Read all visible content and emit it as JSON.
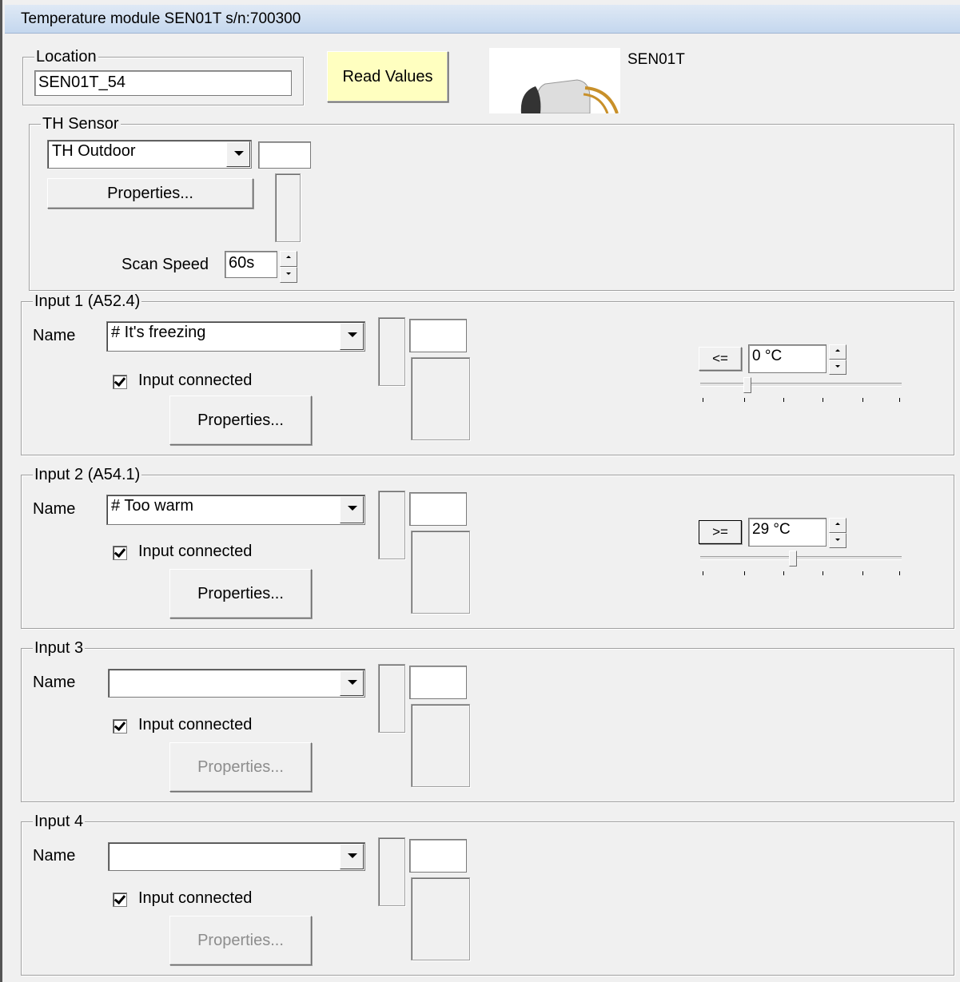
{
  "window": {
    "title": "Temperature module SEN01T s/n:700300"
  },
  "location": {
    "legend": "Location",
    "value": "SEN01T_54"
  },
  "read_values_label": "Read Values",
  "module_name": "SEN01T",
  "th_sensor": {
    "legend": "TH Sensor",
    "selected": "TH Outdoor",
    "properties_label": "Properties...",
    "scan_speed_label": "Scan Speed",
    "scan_speed_value": "60s"
  },
  "inputs": [
    {
      "legend": "Input 1 (A52.4)",
      "name_label": "Name",
      "name_value": "# It's freezing",
      "connected_label": "Input connected",
      "connected": true,
      "properties_label": "Properties...",
      "compare_label": "<=",
      "threshold": "0 °C",
      "slider_level": 0.2,
      "properties_enabled": true
    },
    {
      "legend": "Input 2 (A54.1)",
      "name_label": "Name",
      "name_value": "# Too warm",
      "connected_label": "Input connected",
      "connected": true,
      "properties_label": "Properties...",
      "compare_label": ">=",
      "threshold": "29 °C",
      "slider_level": 0.45,
      "properties_enabled": true
    },
    {
      "legend": "Input 3",
      "name_label": "Name",
      "name_value": "",
      "connected_label": "Input connected",
      "connected": true,
      "properties_label": "Properties...",
      "properties_enabled": false
    },
    {
      "legend": "Input 4",
      "name_label": "Name",
      "name_value": "",
      "connected_label": "Input connected",
      "connected": true,
      "properties_label": "Properties...",
      "properties_enabled": false
    }
  ],
  "colors": {
    "read_button_bg": "#ffffc0",
    "window_bg": "#f0f0f0",
    "title_bg": "#c4d7ee"
  },
  "icons": {
    "dropdown": "chevron-down-icon",
    "spinner": "spin-arrows-icon",
    "check": "check-icon"
  }
}
